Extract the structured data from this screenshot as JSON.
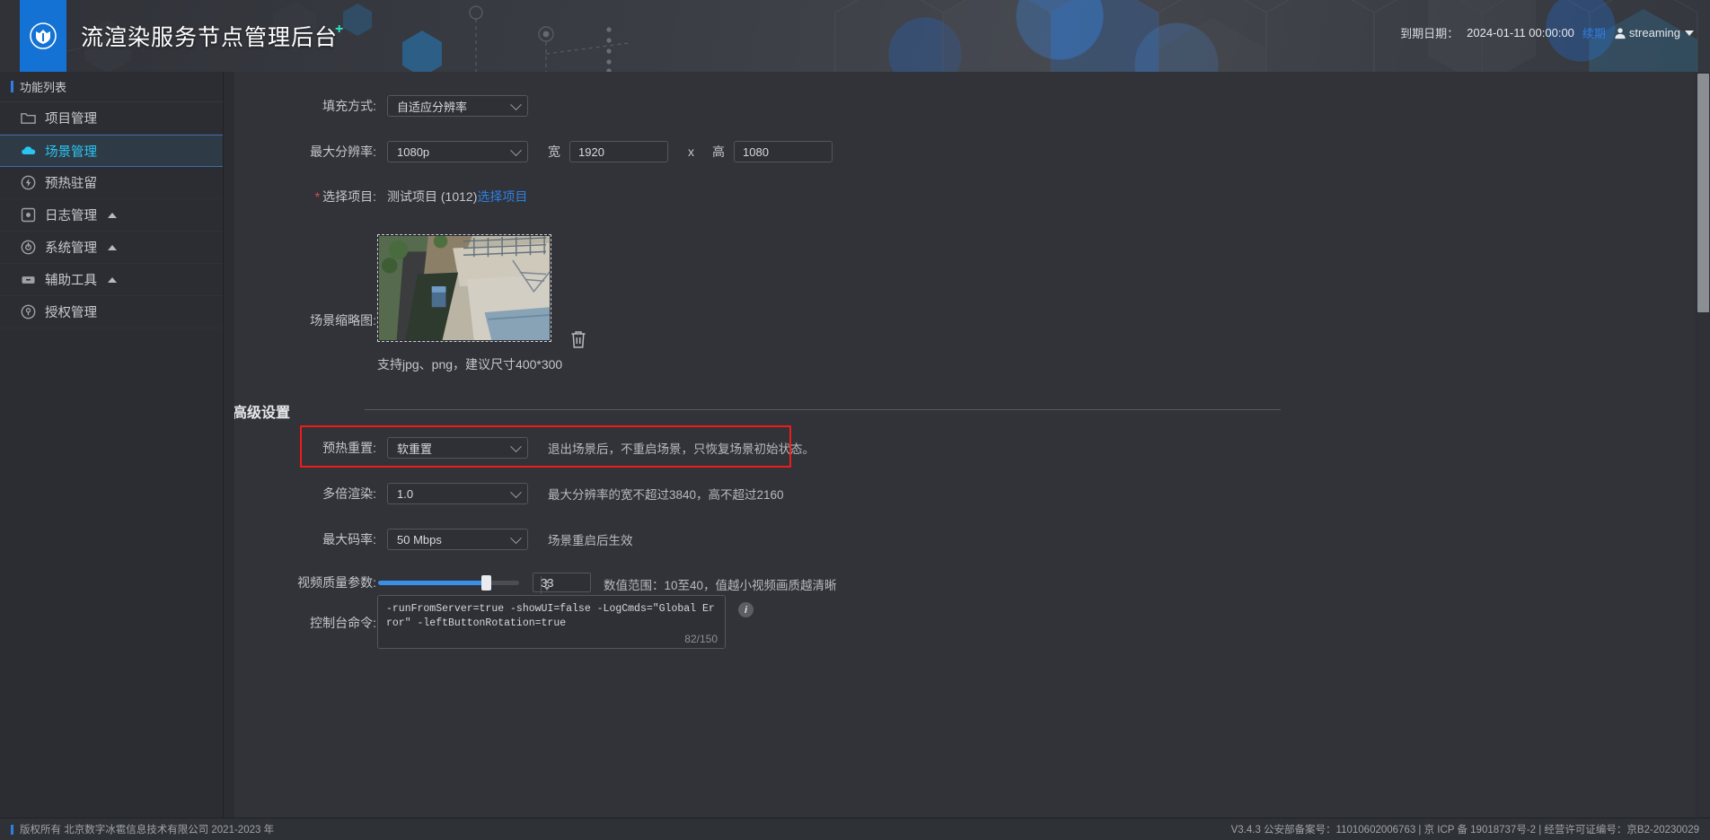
{
  "header": {
    "logo_icon": "shield-logo-icon",
    "title": "流渲染服务节点管理后台",
    "title_superscript": "+",
    "expire_label": "到期日期：",
    "expire_value": "2024-01-11 00:00:00",
    "renew_label": "续期",
    "user_icon": "user-icon",
    "user_name": "streaming",
    "caret_icon": "chevron-down-icon"
  },
  "sidebar": {
    "heading": "功能列表",
    "items": [
      {
        "icon": "folder-icon",
        "label": "项目管理",
        "expandable": false,
        "active": false
      },
      {
        "icon": "cloud-icon",
        "label": "场景管理",
        "expandable": false,
        "active": true
      },
      {
        "icon": "bolt-icon",
        "label": "预热驻留",
        "expandable": false,
        "active": false
      },
      {
        "icon": "log-icon",
        "label": "日志管理",
        "expandable": true,
        "active": false
      },
      {
        "icon": "gear-icon",
        "label": "系统管理",
        "expandable": true,
        "active": false
      },
      {
        "icon": "toolbox-icon",
        "label": "辅助工具",
        "expandable": true,
        "active": false
      },
      {
        "icon": "key-icon",
        "label": "授权管理",
        "expandable": false,
        "active": false
      }
    ],
    "expand_arrow_icon": "chevron-up-icon"
  },
  "form": {
    "fill_mode": {
      "label": "填充方式:",
      "value": "自适应分辨率"
    },
    "max_resolution": {
      "label": "最大分辨率:",
      "value": "1080p",
      "width_label": "宽",
      "width_value": "1920",
      "separator": "x",
      "height_label": "高",
      "height_value": "1080"
    },
    "project": {
      "required_mark": "*",
      "label": "选择项目:",
      "value": "测试项目 (1012)",
      "link": "选择项目"
    },
    "thumbnail": {
      "label": "场景缩略图:",
      "delete_icon": "trash-icon",
      "note": "支持jpg、png，建议尺寸400*300"
    }
  },
  "advanced": {
    "title": "高级设置",
    "preheat_reset": {
      "label": "预热重置:",
      "value": "软重置",
      "hint": "退出场景后，不重启场景，只恢复场景初始状态。",
      "highlight_color": "#ee1b1b"
    },
    "multi_render": {
      "label": "多倍渲染:",
      "value": "1.0",
      "hint": "最大分辨率的宽不超过3840，高不超过2160"
    },
    "max_bitrate": {
      "label": "最大码率:",
      "value": "50 Mbps",
      "hint": "场景重启后生效"
    },
    "video_quality": {
      "label": "视频质量参数:",
      "value": "33",
      "hint": "数值范围：10至40，值越小视频画质越清晰",
      "slider_min": 10,
      "slider_max": 40,
      "slider_fill_color": "#3b8fe8"
    },
    "console_command": {
      "label": "控制台命令:",
      "value": "-runFromServer=true -showUI=false -LogCmds=\"Global Error\" -leftButtonRotation=true",
      "counter": "82/150",
      "info_icon": "info-icon"
    }
  },
  "footer": {
    "copyright": "版权所有 北京数字冰雹信息技术有限公司 2021-2023 年",
    "right": "V3.4.3 公安部备案号：11010602006763 | 京 ICP 备 19018737号-2 | 经营许可证编号：京B2-20230029"
  },
  "colors": {
    "accent": "#2f7fe0",
    "active_text": "#29c6f0",
    "danger": "#ee1b1b"
  }
}
